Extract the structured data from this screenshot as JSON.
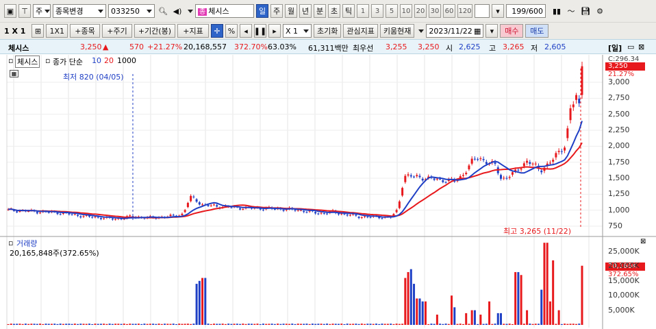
{
  "toolbar": {
    "market_select": "주",
    "code_mode_button": "종목변경",
    "stock_code": "033250",
    "stock_chip": "종",
    "stock_name": "체시스",
    "period_tabs": [
      "일",
      "주",
      "월",
      "년",
      "분",
      "초",
      "틱"
    ],
    "active_period": "일",
    "interval_buttons": [
      "1",
      "3",
      "5",
      "10",
      "20",
      "30",
      "60",
      "120"
    ],
    "count_value": "199/600"
  },
  "toolbar2": {
    "layout_label": "1 X 1",
    "layout_1x1": "1X1",
    "btn_add_stock": "+종목",
    "btn_add_period": "+주기",
    "btn_add_range": "+기간(봉)",
    "btn_add_indicator": "+지표",
    "percent_label": "%",
    "multiplier_value": "X 1",
    "reset_button": "초기화",
    "watchlist_button": "관심지표",
    "kiwoom_button": "키움현재",
    "date_value": "2023/11/22",
    "buy_button": "매수",
    "sell_button": "매도"
  },
  "infobar": {
    "name": "체시스",
    "price": "3,250",
    "change": "570",
    "change_pct": "+21.27%",
    "volume": "20,168,557",
    "volume_ratio": "372.70%",
    "ratio2": "63.03%",
    "amount": "61,311백만",
    "priority_label": "최우선",
    "ask": "3,255",
    "bid": "3,250",
    "open_label": "시",
    "open": "2,625",
    "high_label": "고",
    "high": "3,265",
    "low_label": "저",
    "low": "2,605",
    "period_label": "[일]"
  },
  "price_panel": {
    "legend_name": "체시스",
    "legend_ma_text": "종가 단순",
    "ma_periods": [
      "10",
      "20",
      "1000"
    ],
    "low_annotation": "최저 820 (04/05)",
    "high_annotation": "최고 3,265 (11/22)",
    "right_readout": "C:296.34",
    "price_tag": "3,250",
    "pct_tag": "21.27%",
    "y_ticks": [
      "3,000",
      "2,750",
      "2,500",
      "2,250",
      "2,000",
      "1,750",
      "1,500",
      "1,250",
      "1,000",
      "750"
    ]
  },
  "volume_panel": {
    "title": "거래량",
    "summary": "20,165,848주(372.65%)",
    "volume_tag": "20,166K",
    "pct_tag": "372.65%",
    "y_ticks": [
      "25,000K",
      "20,000K",
      "15,000K",
      "10,000K",
      "5,000K"
    ]
  },
  "colors": {
    "up": "#e8191c",
    "down": "#1f3fc5",
    "ma10": "#1f3fc5",
    "ma20": "#e8191c",
    "active_tab": "#2e63c7",
    "info_bg": "#e7f3f8"
  },
  "chart_data": {
    "type": "candlestick",
    "price_axis_ticks": [
      3000,
      2750,
      2500,
      2250,
      2000,
      1750,
      1500,
      1250,
      1000,
      750
    ],
    "volume_axis_ticks_K": [
      25000,
      20000,
      15000,
      10000,
      5000
    ],
    "low_point": {
      "label": "04/05",
      "value": 820
    },
    "high_point": {
      "label": "11/22",
      "value": 3265
    },
    "last_close": 3250,
    "ma_periods": [
      10,
      20,
      1000
    ]
  }
}
